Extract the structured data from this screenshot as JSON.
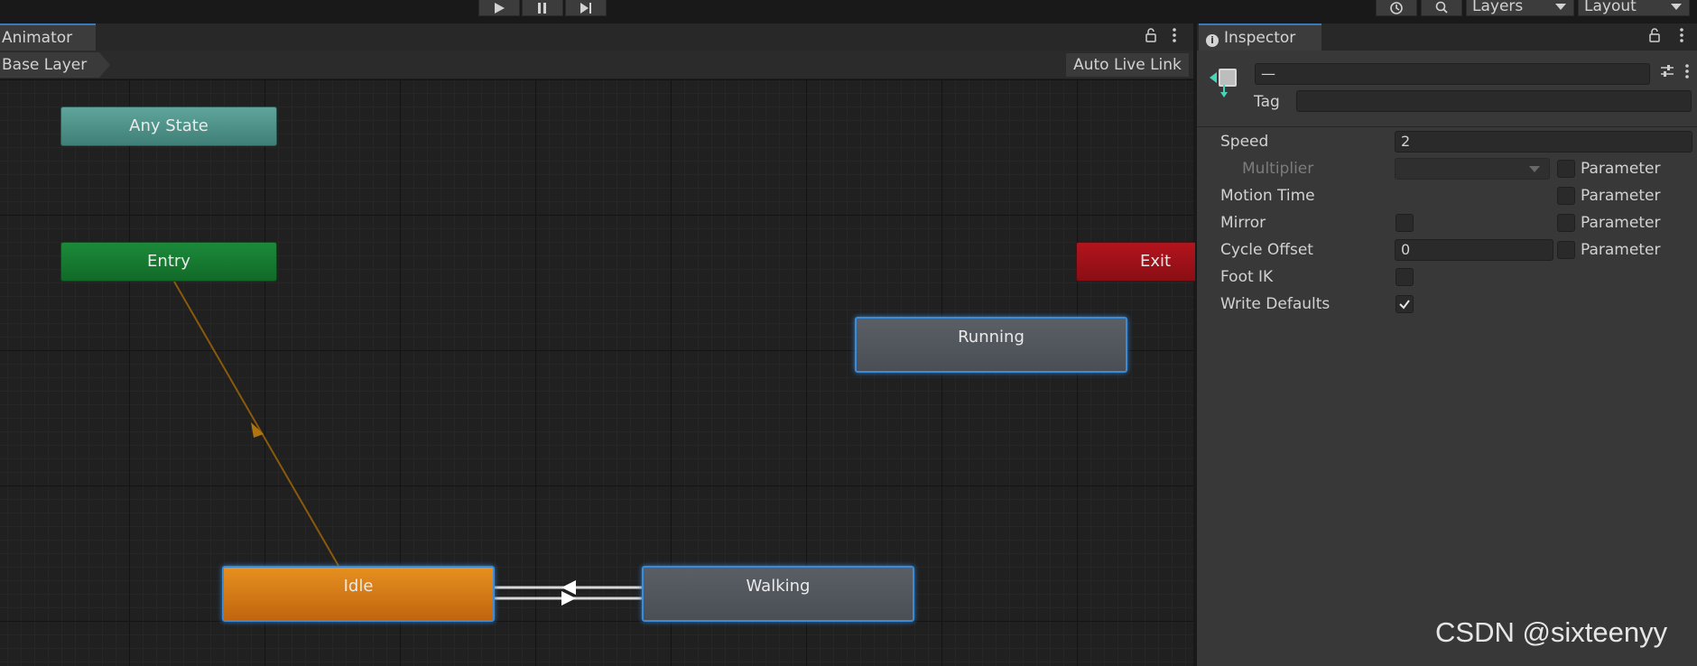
{
  "toolbar": {
    "play_icon": "play-icon",
    "pause_icon": "pause-icon",
    "step_icon": "step-icon",
    "history_icon": "history-icon",
    "search_icon": "search-icon",
    "layers_label": "Layers",
    "layout_label": "Layout"
  },
  "animator": {
    "tab_label": "Animator",
    "breadcrumb": "Base Layer",
    "auto_live_link": "Auto Live Link",
    "nodes": {
      "any_state": "Any State",
      "entry": "Entry",
      "exit": "Exit",
      "running": "Running",
      "idle": "Idle",
      "walking": "Walking"
    }
  },
  "inspector": {
    "tab_label": "Inspector",
    "name_value": "—",
    "tag_label": "Tag",
    "tag_value": "",
    "rows": {
      "speed_label": "Speed",
      "speed_value": "2",
      "multiplier_label": "Multiplier",
      "motion_time_label": "Motion Time",
      "mirror_label": "Mirror",
      "cycle_offset_label": "Cycle Offset",
      "cycle_offset_value": "0",
      "foot_ik_label": "Foot IK",
      "write_defaults_label": "Write Defaults",
      "parameter_label": "Parameter"
    },
    "write_defaults_checked": true
  },
  "colors": {
    "accent_blue": "#3a79bb",
    "idle_orange": "#e6901f",
    "entry_green": "#1c8a3a",
    "any_state_teal": "#5fa59b",
    "exit_red": "#b4141d"
  },
  "watermark": "CSDN @sixteenyy"
}
